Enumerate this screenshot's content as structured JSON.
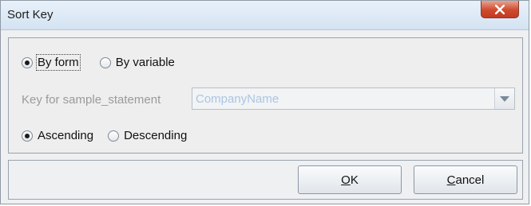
{
  "window": {
    "title": "Sort Key"
  },
  "sort_source": {
    "options": [
      {
        "label": "By form",
        "checked": true
      },
      {
        "label": "By variable",
        "checked": false
      }
    ]
  },
  "key": {
    "label": "Key for sample_statement",
    "value": "CompanyName",
    "enabled": false
  },
  "order": {
    "options": [
      {
        "label": "Ascending",
        "checked": true
      },
      {
        "label": "Descending",
        "checked": false
      }
    ]
  },
  "buttons": {
    "ok": {
      "mnemonic": "O",
      "rest": "K"
    },
    "cancel": {
      "mnemonic": "C",
      "rest": "ancel"
    }
  },
  "colors": {
    "close_button": "#cf4a2f",
    "disabled_text": "#9a9a9a",
    "combo_text": "#a9c6e5"
  },
  "icons": {
    "close": "close-icon",
    "dropdown": "chevron-down-icon"
  }
}
